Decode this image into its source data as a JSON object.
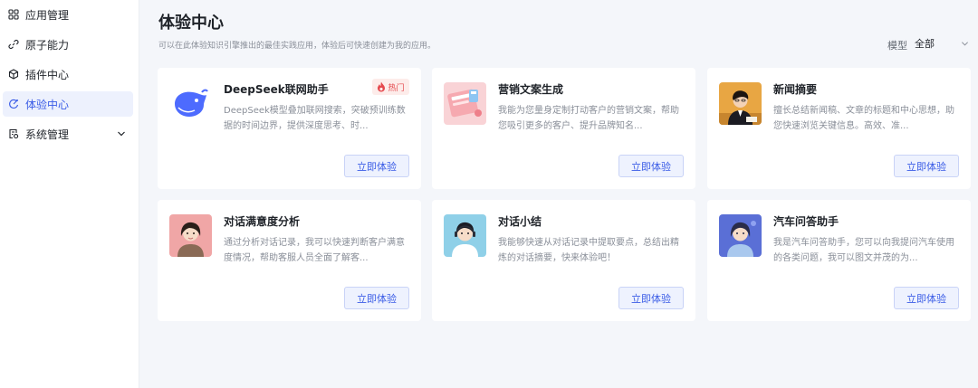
{
  "sidebar": {
    "items": [
      {
        "label": "应用管理",
        "icon": "grid-icon"
      },
      {
        "label": "原子能力",
        "icon": "link-icon"
      },
      {
        "label": "插件中心",
        "icon": "cube-icon"
      },
      {
        "label": "体验中心",
        "icon": "experience-icon",
        "active": true
      },
      {
        "label": "系统管理",
        "icon": "settings-doc-icon",
        "expandable": true
      }
    ]
  },
  "header": {
    "title": "体验中心",
    "subtitle": "可以在此体验知识引擎推出的最佳实践应用，体验后可快速创建为我的应用。"
  },
  "filter": {
    "label": "模型",
    "value": "全部"
  },
  "colors": {
    "accent": "#3a5ce6",
    "hot": "#e5484d"
  },
  "cards": [
    {
      "title": "DeepSeek联网助手",
      "desc": "DeepSeek模型叠加联网搜索，突破预训练数据的时间边界，提供深度思考、时...",
      "button": "立即体验",
      "badge": "热门",
      "image": "deepseek-whale-logo"
    },
    {
      "title": "营销文案生成",
      "desc": "我能为您量身定制打动客户的营销文案，帮助您吸引更多的客户、提升品牌知名...",
      "button": "立即体验",
      "image": "marketing-illustration"
    },
    {
      "title": "新闻摘要",
      "desc": "擅长总结新闻稿、文章的标题和中心思想，助您快速浏览关键信息。高效、准...",
      "button": "立即体验",
      "image": "news-avatar"
    },
    {
      "title": "对话满意度分析",
      "desc": "通过分析对话记录，我可以快速判断客户满意度情况，帮助客服人员全面了解客...",
      "button": "立即体验",
      "image": "satisfaction-avatar"
    },
    {
      "title": "对话小结",
      "desc": "我能够快速从对话记录中提取要点，总结出精炼的对话摘要，快来体验吧！",
      "button": "立即体验",
      "image": "summary-avatar"
    },
    {
      "title": "汽车问答助手",
      "desc": "我是汽车问答助手，您可以向我提问汽车使用的各类问题，我可以图文并茂的为...",
      "button": "立即体验",
      "image": "car-qa-avatar"
    }
  ]
}
